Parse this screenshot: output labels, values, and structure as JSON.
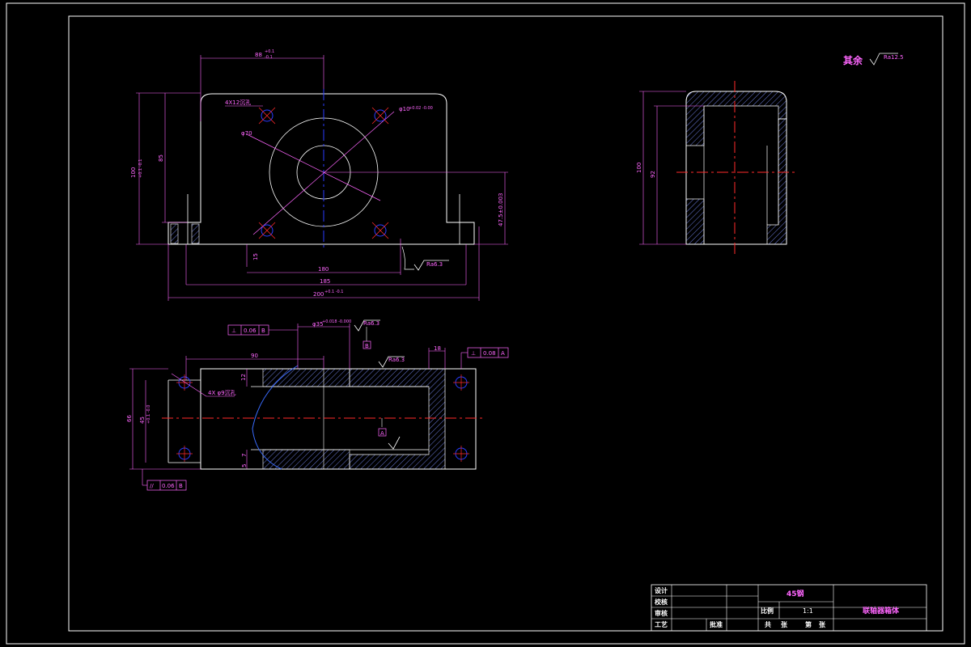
{
  "colors": {
    "background": "#000000",
    "outline": "#ffffff",
    "dimension": "#ff66ff",
    "centerline_red": "#ff2a2a",
    "centerline_blue": "#2a3cff",
    "hatch": "#6a7ad8",
    "profile_blue": "#3a6cff"
  },
  "surface_note": {
    "label": "其余",
    "roughness": "Ra12.5"
  },
  "front_view": {
    "dims": {
      "top_width": "88",
      "top_tol_upper": "+0.1",
      "top_tol_lower": "-0.1",
      "holes_4x": "4X12沉孔",
      "hole_dia": "φ10",
      "hole_tol": "+0.02 -0.00",
      "bore_dia": "φ70",
      "total_height": "100",
      "total_height_tol": "+0.1 -0.1",
      "height_85": "85",
      "center_height": "47.5±0.003",
      "base_thk": "15",
      "hole_spacing": "180",
      "span_185": "185",
      "total_width": "200",
      "total_width_tol": "+0.1 -0.1",
      "roughness": "Ra6.3"
    }
  },
  "side_view": {
    "dims": {
      "height_100": "100",
      "height_92": "92"
    }
  },
  "top_view": {
    "dims": {
      "gdt_perp": "⊥",
      "gdt_perp_value": "0.06",
      "gdt_perp_datum": "B",
      "bore_dia": "φ35",
      "bore_tol": "+0.018 -0.000",
      "roughness_a": "Ra6.3",
      "datum_b": "B",
      "width_90": "90",
      "roughness_b": "Ra6.3",
      "dim_18": "18",
      "gdt2_sym": "⊥",
      "gdt2_value": "0.08",
      "gdt2_datum": "A",
      "dim_12": "12",
      "holes_4x": "4X φ9沉孔",
      "total_depth": "66",
      "inner_depth": "45",
      "inner_tol": "+0.1 -0.0",
      "datum_a": "A",
      "dim_5": "5",
      "dim_7": "7",
      "gdt3_sym": "//",
      "gdt3_value": "0.06",
      "gdt3_datum": "B"
    }
  },
  "title_block": {
    "design": "设计",
    "check": "校核",
    "review": "审核",
    "process": "工艺",
    "approve": "批准",
    "material": "45钢",
    "scale_label": "比例",
    "scale_value": "1:1",
    "part_name": "联轴器箱体",
    "sheet_total_a": "共",
    "sheet_total_b": "张",
    "sheet_no_a": "第",
    "sheet_no_b": "张"
  }
}
